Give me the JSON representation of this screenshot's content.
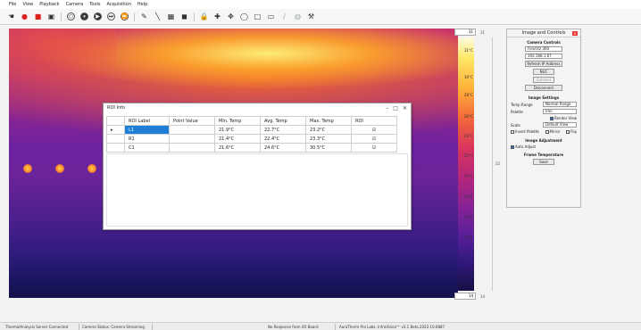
{
  "menu": [
    "File",
    "View",
    "Playback",
    "Camera",
    "Tools",
    "Acquisition",
    "Help"
  ],
  "toolbar": {
    "icons": [
      "hand-icon",
      "record-icon",
      "stop-icon",
      "snapshot-icon",
      "circle-icon",
      "pause-icon",
      "play-icon",
      "next-icon",
      "last-icon",
      "pen-icon",
      "line-icon",
      "area-icon",
      "spot-icon",
      "lock-icon",
      "target-icon",
      "move-icon",
      "circle-roi-icon",
      "square-roi-icon",
      "rect-roi-icon",
      "erase-icon",
      "palette-icon",
      "settings-icon"
    ],
    "glyphs": [
      "☚",
      "●",
      "■",
      "▣",
      "○",
      "⏸",
      "▶",
      "⏭",
      "⏩",
      "✎",
      "╲",
      "▦",
      "◼",
      "🔒",
      "✚",
      "✥",
      "◯",
      "□",
      "▭",
      "∕",
      "◍",
      "⚒"
    ]
  },
  "roi_window": {
    "title": "ROI Info",
    "controls": [
      "–",
      "□",
      "✕"
    ],
    "columns": [
      "ROI Label",
      "Point Value",
      "Min. Temp",
      "Avg. Temp",
      "Max. Temp",
      "ROI"
    ],
    "rows": [
      {
        "label": "L1",
        "point": "",
        "min": "21.9°C",
        "avg": "22.7°C",
        "max": "23.2°C",
        "roi": "☑"
      },
      {
        "label": "R1",
        "point": "",
        "min": "21.4°C",
        "avg": "22.4°C",
        "max": "23.3°C",
        "roi": "☑"
      },
      {
        "label": "C1",
        "point": "",
        "min": "21.6°C",
        "avg": "24.6°C",
        "max": "30.5°C",
        "roi": "☑"
      }
    ]
  },
  "scale": {
    "top_value": "31",
    "top_side": "31",
    "bottom_value": "14",
    "bottom_side": "14",
    "mid_side": "22",
    "ticks": [
      "31°C",
      "30°C",
      "28°C",
      "26°C",
      "24°C",
      "22°C",
      "20°C",
      "18°C",
      "16°C",
      "14°C"
    ]
  },
  "panel": {
    "title": "Image and Controls",
    "camera_section": "Camera Controls",
    "camera_model": "FlexiViz 360",
    "ip_address": "192.168.1.67",
    "buttons": [
      "Refresh IP Address",
      "NUC",
      "Connect",
      "Disconnect"
    ],
    "image_section": "Image Settings",
    "temp_range_label": "Temp Range",
    "temp_range_value": "Normal Range",
    "palette_label": "Palette",
    "palette_value": "Iron",
    "render_view": "Render View",
    "scale_label": "Scale",
    "scale_value": "Default View",
    "checks": [
      "Invert Palette",
      "Mirror",
      "Flip"
    ],
    "adjust_section": "Image Adjustment",
    "auto_adjust": "Auto Adjust",
    "frame_section": "Frame Temperature",
    "save_btn": "Save"
  },
  "status": {
    "conn": "ThermalAnalysis Server Connected",
    "camera": "Camera Status: Camera Streaming",
    "board": "No Response from I/O Board",
    "version": "AuraTherm Pro Labs, InfraVision™ v3.1 Beta 2022-10.0887"
  }
}
